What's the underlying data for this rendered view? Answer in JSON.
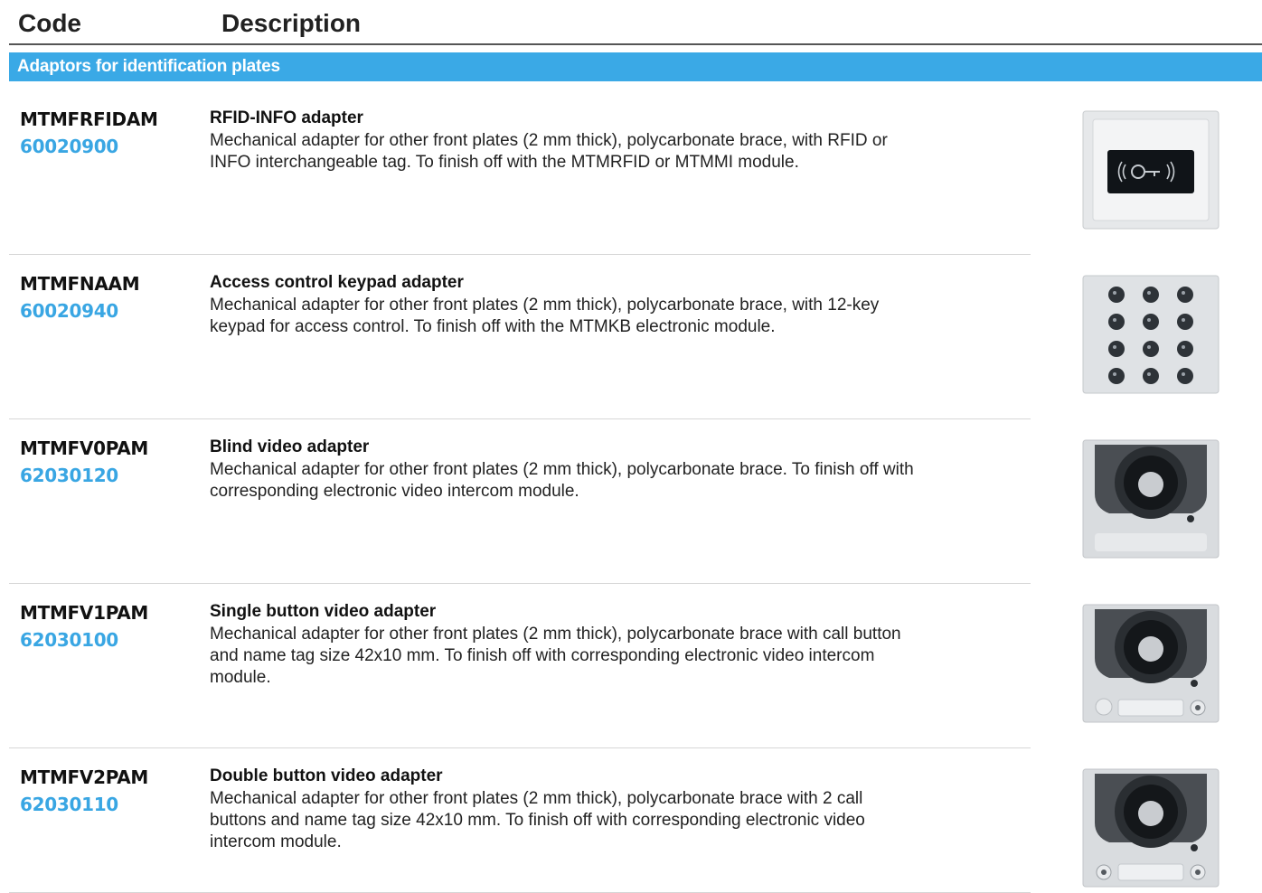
{
  "header": {
    "code_label": "Code",
    "description_label": "Description"
  },
  "section": {
    "title": "Adaptors for identification plates"
  },
  "items": [
    {
      "code": "MTMFRFIDAM",
      "number": "60020900",
      "title": "RFID-INFO adapter",
      "description": "Mechanical adapter for other front plates (2 mm thick), polycarbonate brace, with RFID or INFO interchangeable tag. To finish off with the MTMRFID or MTMMI module.",
      "image": "rfid-reader-module"
    },
    {
      "code": "MTMFNAAM",
      "number": "60020940",
      "title": "Access control keypad adapter",
      "description": "Mechanical adapter for other front plates (2 mm thick), polycarbonate brace, with 12-key keypad for access control. To finish off with the MTMKB electronic module.",
      "image": "keypad-module"
    },
    {
      "code": "MTMFV0PAM",
      "number": "62030120",
      "title": "Blind video adapter",
      "description": "Mechanical adapter for other front plates (2 mm thick), polycarbonate brace. To finish off with corresponding electronic video intercom module.",
      "image": "video-camera-module"
    },
    {
      "code": "MTMFV1PAM",
      "number": "62030100",
      "title": "Single button video adapter",
      "description": "Mechanical adapter for other front plates (2 mm thick), polycarbonate brace with call button and name tag size 42x10 mm. To finish off with corresponding electronic video intercom module.",
      "image": "video-camera-single-button-module"
    },
    {
      "code": "MTMFV2PAM",
      "number": "62030110",
      "title": "Double button video adapter",
      "description": "Mechanical adapter for other front plates (2 mm thick), polycarbonate brace with 2 call buttons and name tag size 42x10 mm. To finish off with corresponding electronic video intercom module.",
      "image": "video-camera-double-button-module"
    }
  ]
}
